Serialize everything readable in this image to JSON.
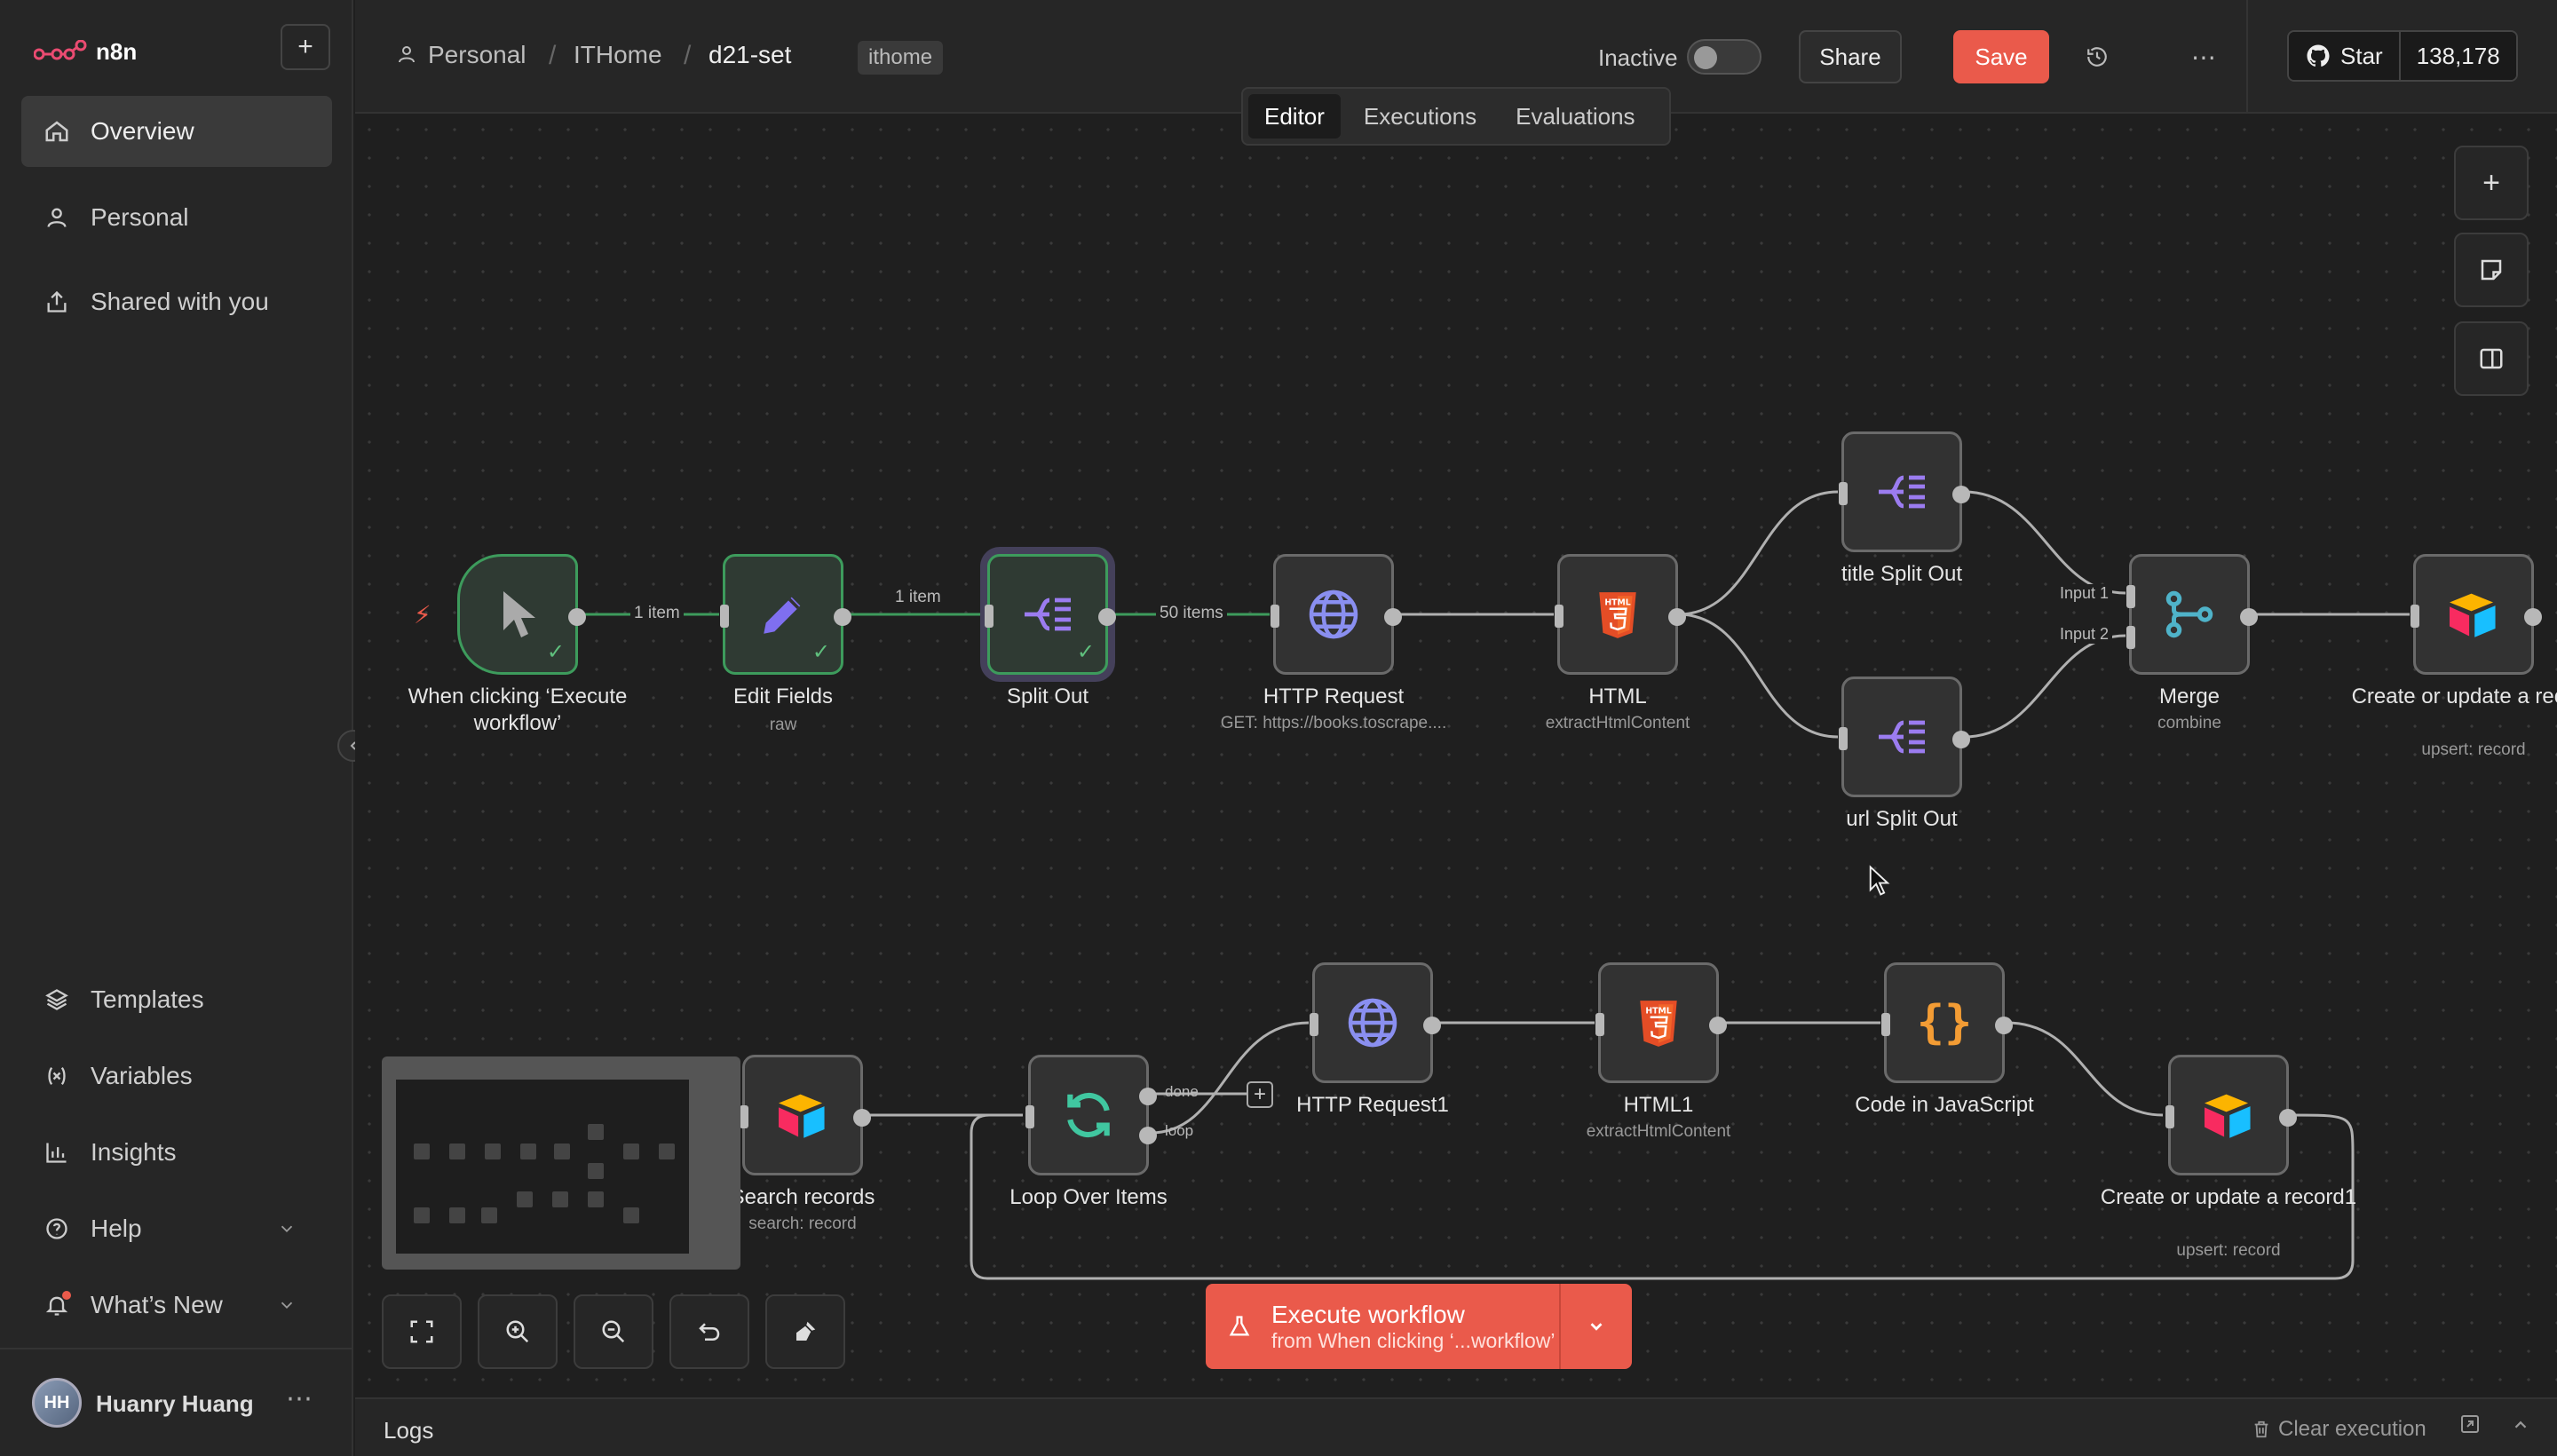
{
  "sidebar": {
    "logo_text": "n8n",
    "items_top": [
      {
        "label": "Overview",
        "icon": "home-icon"
      },
      {
        "label": "Personal",
        "icon": "user-icon"
      },
      {
        "label": "Shared with you",
        "icon": "share-icon"
      }
    ],
    "items_bottom": [
      {
        "label": "Templates",
        "icon": "templates-icon"
      },
      {
        "label": "Variables",
        "icon": "variables-icon"
      },
      {
        "label": "Insights",
        "icon": "insights-icon"
      },
      {
        "label": "Help",
        "icon": "help-icon"
      },
      {
        "label": "What’s New",
        "icon": "bell-icon"
      }
    ],
    "user": {
      "initials": "HH",
      "name": "Huanry Huang"
    }
  },
  "header": {
    "breadcrumb": [
      "Personal",
      "ITHome",
      "d21-set"
    ],
    "tag": "ithome",
    "status_label": "Inactive",
    "share_label": "Share",
    "save_label": "Save",
    "github_star_label": "Star",
    "github_star_count": "138,178"
  },
  "tabs": [
    "Editor",
    "Executions",
    "Evaluations"
  ],
  "nodes": {
    "trigger": {
      "label": "When clicking ‘Execute workflow’"
    },
    "edit_fields": {
      "label": "Edit Fields",
      "sub": "raw"
    },
    "split_out": {
      "label": "Split Out"
    },
    "http_request": {
      "label": "HTTP Request",
      "sub": "GET: https://books.toscrape...."
    },
    "html": {
      "label": "HTML",
      "sub": "extractHtmlContent"
    },
    "title_split": {
      "label": "title Split Out"
    },
    "url_split": {
      "label": "url Split Out"
    },
    "merge": {
      "label": "Merge",
      "sub": "combine",
      "input1": "Input 1",
      "input2": "Input 2"
    },
    "create_record": {
      "label": "Create or update a record",
      "sub": "upsert: record"
    },
    "search_records": {
      "label": "Search records",
      "sub": "search: record"
    },
    "loop": {
      "label": "Loop Over Items",
      "done": "done",
      "loop": "loop"
    },
    "http_request1": {
      "label": "HTTP Request1"
    },
    "html1": {
      "label": "HTML1",
      "sub": "extractHtmlContent"
    },
    "code": {
      "label": "Code in JavaScript"
    },
    "create_record1": {
      "label": "Create or update a record1",
      "sub": "upsert: record"
    }
  },
  "edges": {
    "e1": "1 item",
    "e2": "1 item",
    "e3": "50 items"
  },
  "execute": {
    "title": "Execute workflow",
    "subtitle": "from When clicking ‘...workflow’"
  },
  "logs": {
    "title": "Logs",
    "clear_label": "Clear execution"
  },
  "colors": {
    "accent": "#ea5a4b",
    "success": "#3d9b5c",
    "background": "#1f1f1f"
  }
}
